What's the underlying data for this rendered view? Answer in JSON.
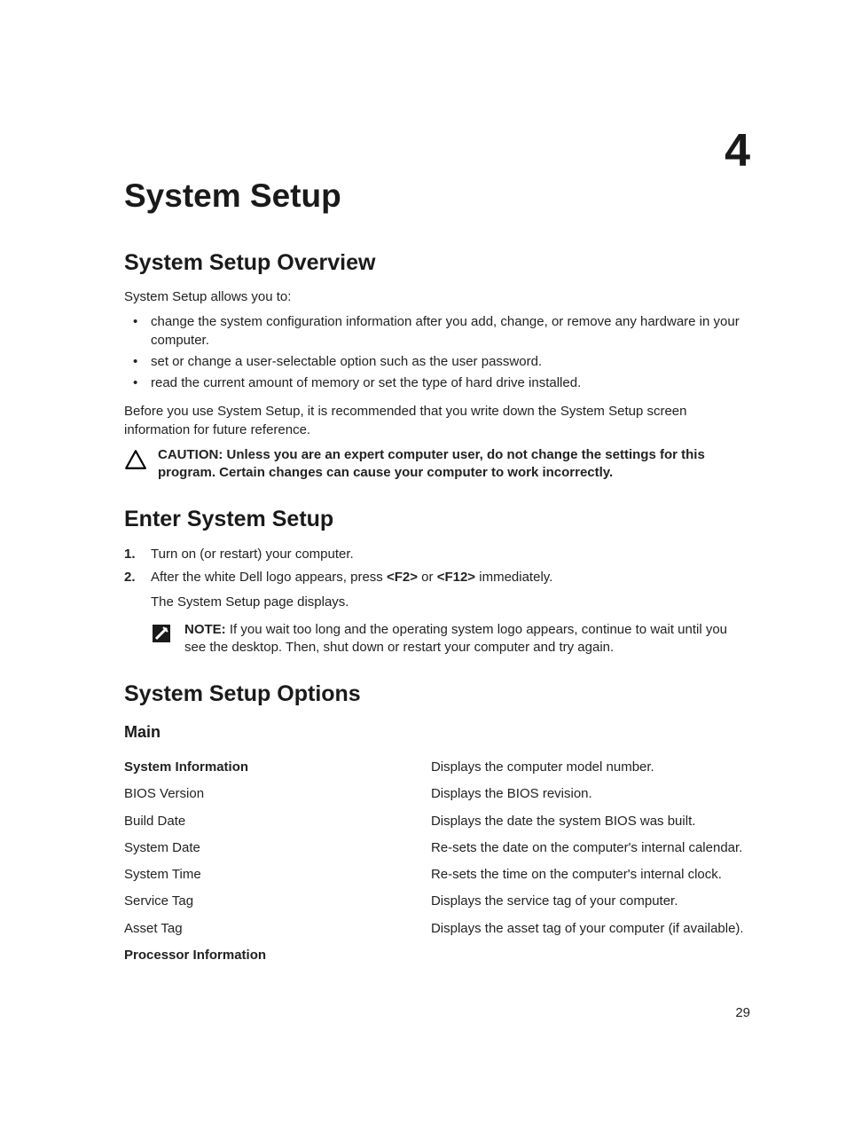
{
  "chapter_number": "4",
  "title": "System Setup",
  "s1": {
    "heading": "System Setup Overview",
    "intro": "System Setup allows you to:",
    "bullets": [
      "change the system configuration information after you add, change, or remove any hardware in your computer.",
      "set or change a user-selectable option such as the user password.",
      "read the current amount of memory or set the type of hard drive installed."
    ],
    "after": "Before you use System Setup, it is recommended that you write down the System Setup screen information for future reference.",
    "caution_lead": "CAUTION: ",
    "caution_body": "Unless you are an expert computer user, do not change the settings for this program. Certain changes can cause your computer to work incorrectly."
  },
  "s2": {
    "heading": "Enter System Setup",
    "step1": "Turn on (or restart) your computer.",
    "step2_pre": "After the white Dell logo appears, press ",
    "step2_k1": "<F2>",
    "step2_mid": " or ",
    "step2_k2": "<F12>",
    "step2_post": " immediately.",
    "step2_sub": "The System Setup page displays.",
    "note_lead": "NOTE: ",
    "note_body": "If you wait too long and the operating system logo appears, continue to wait until you see the desktop. Then, shut down or restart your computer and try again."
  },
  "s3": {
    "heading": "System Setup Options",
    "sub": "Main",
    "rows": [
      {
        "k": "System Information",
        "v": "Displays the computer model number.",
        "sect": true
      },
      {
        "k": "BIOS Version",
        "v": "Displays the BIOS revision."
      },
      {
        "k": "Build Date",
        "v": "Displays the date the system BIOS was built."
      },
      {
        "k": "System Date",
        "v": "Re-sets the date on the computer's internal calendar."
      },
      {
        "k": "System Time",
        "v": "Re-sets the time on the computer's internal clock."
      },
      {
        "k": "Service Tag",
        "v": "Displays the service tag of your computer."
      },
      {
        "k": "Asset Tag",
        "v": "Displays the asset tag of your computer (if available)."
      },
      {
        "k": "Processor Information",
        "v": "",
        "sect": true
      }
    ]
  },
  "page_number": "29"
}
